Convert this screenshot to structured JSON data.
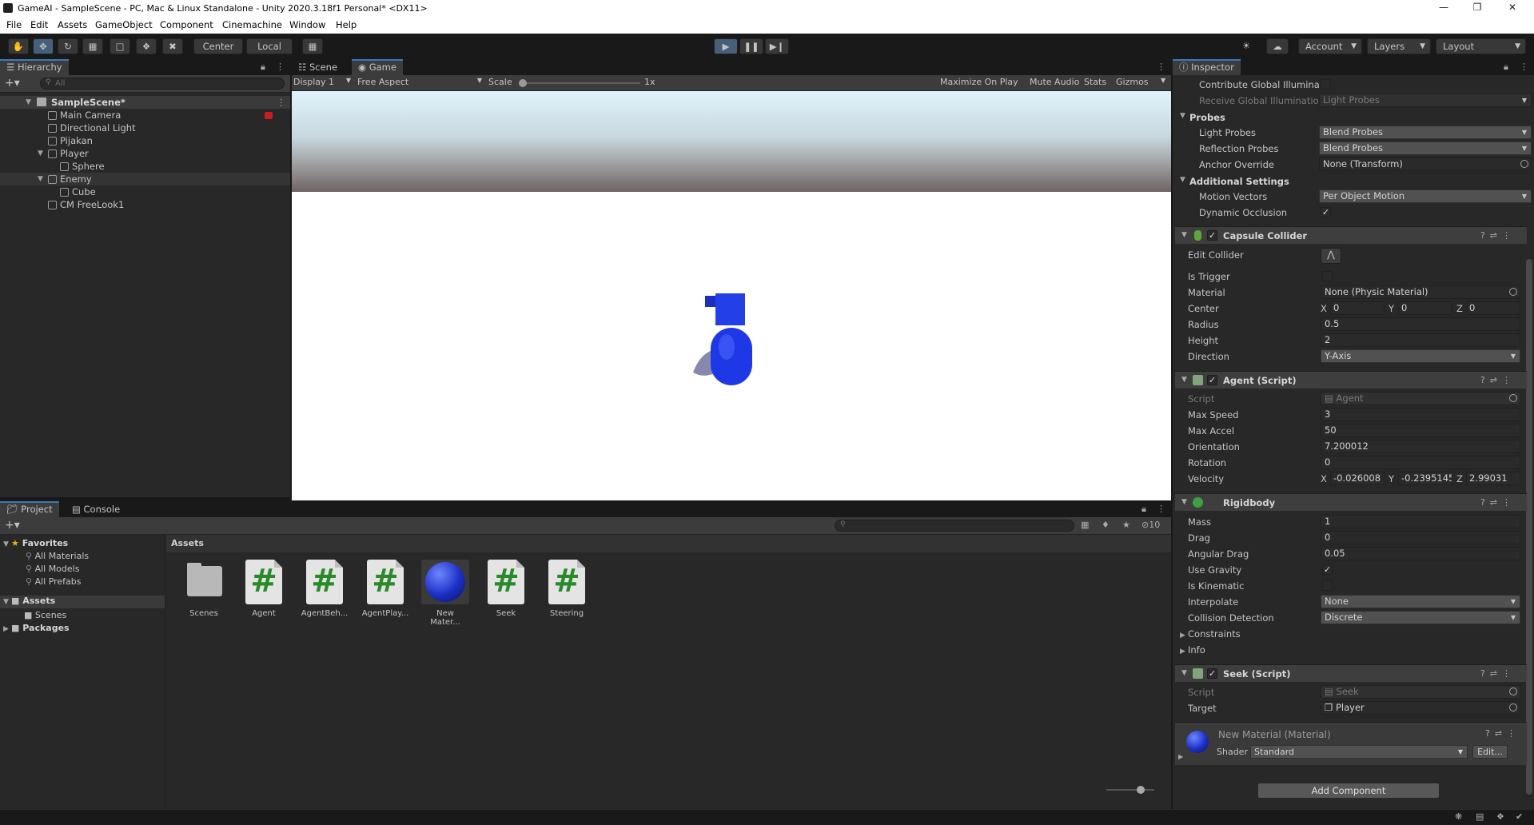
{
  "window": {
    "title": "GameAI - SampleScene - PC, Mac & Linux Standalone - Unity 2020.3.18f1 Personal* <DX11>"
  },
  "menu": [
    "File",
    "Edit",
    "Assets",
    "GameObject",
    "Component",
    "Cinemachine",
    "Window",
    "Help"
  ],
  "toolbar": {
    "pivot": "Center",
    "space": "Local",
    "account": "Account",
    "layers": "Layers",
    "layout": "Layout"
  },
  "hierarchy": {
    "tab": "Hierarchy",
    "search_placeholder": "All",
    "scene": "SampleScene*",
    "items": [
      {
        "label": "Main Camera"
      },
      {
        "label": "Directional Light"
      },
      {
        "label": "Pijakan"
      },
      {
        "label": "Player"
      },
      {
        "label": "Sphere"
      },
      {
        "label": "Enemy"
      },
      {
        "label": "Cube"
      },
      {
        "label": "CM FreeLook1"
      }
    ]
  },
  "game": {
    "tabs": [
      "Scene",
      "Game"
    ],
    "display": "Display 1",
    "aspect": "Free Aspect",
    "scale_label": "Scale",
    "scale_value": "1x",
    "buttons": [
      "Maximize On Play",
      "Mute Audio",
      "Stats",
      "Gizmos"
    ]
  },
  "project": {
    "tabs": [
      "Project",
      "Console"
    ],
    "favorites": "Favorites",
    "fav_items": [
      "All Materials",
      "All Models",
      "All Prefabs"
    ],
    "assets_label": "Assets",
    "asset_folders": [
      "Scenes"
    ],
    "packages": "Packages",
    "breadcrumb": "Assets",
    "hidden_count": "10",
    "files": [
      {
        "name": "Scenes",
        "kind": "folder"
      },
      {
        "name": "Agent",
        "kind": "script"
      },
      {
        "name": "AgentBeh...",
        "kind": "script"
      },
      {
        "name": "AgentPlay...",
        "kind": "script"
      },
      {
        "name": "New Mater...",
        "kind": "material"
      },
      {
        "name": "Seek",
        "kind": "script"
      },
      {
        "name": "Steering",
        "kind": "script"
      }
    ]
  },
  "inspector": {
    "tab": "Inspector",
    "renderer": {
      "contribute_gi": "Contribute Global Illuminat",
      "receive_gi": "Receive Global Illuminatior",
      "receive_gi_value": "Light Probes",
      "probes": "Probes",
      "light_probes": "Light Probes",
      "light_probes_value": "Blend Probes",
      "reflection_probes": "Reflection Probes",
      "reflection_probes_value": "Blend Probes",
      "anchor_override": "Anchor Override",
      "anchor_override_value": "None (Transform)",
      "additional": "Additional Settings",
      "motion_vectors": "Motion Vectors",
      "motion_vectors_value": "Per Object Motion",
      "dynamic_occlusion": "Dynamic Occlusion"
    },
    "capsule": {
      "title": "Capsule Collider",
      "edit_collider": "Edit Collider",
      "is_trigger": "Is Trigger",
      "material": "Material",
      "material_value": "None (Physic Material)",
      "center": "Center",
      "center_x": "0",
      "center_y": "0",
      "center_z": "0",
      "radius": "Radius",
      "radius_value": "0.5",
      "height": "Height",
      "height_value": "2",
      "direction": "Direction",
      "direction_value": "Y-Axis"
    },
    "agent": {
      "title": "Agent (Script)",
      "script": "Script",
      "script_value": "Agent",
      "max_speed": "Max Speed",
      "max_speed_value": "3",
      "max_accel": "Max Accel",
      "max_accel_value": "50",
      "orientation": "Orientation",
      "orientation_value": "7.200012",
      "rotation": "Rotation",
      "rotation_value": "0",
      "velocity": "Velocity",
      "vel_x": "-0.026008",
      "vel_y": "-0.2395145",
      "vel_z": "2.99031"
    },
    "rigidbody": {
      "title": "Rigidbody",
      "mass": "Mass",
      "mass_value": "1",
      "drag": "Drag",
      "drag_value": "0",
      "angular_drag": "Angular Drag",
      "angular_drag_value": "0.05",
      "use_gravity": "Use Gravity",
      "is_kinematic": "Is Kinematic",
      "interpolate": "Interpolate",
      "interpolate_value": "None",
      "collision": "Collision Detection",
      "collision_value": "Discrete",
      "constraints": "Constraints",
      "info": "Info"
    },
    "seek": {
      "title": "Seek (Script)",
      "script": "Script",
      "script_value": "Seek",
      "target": "Target",
      "target_value": "Player"
    },
    "material": {
      "title": "New Material (Material)",
      "shader": "Shader",
      "shader_value": "Standard",
      "edit": "Edit..."
    },
    "add_component": "Add Component"
  },
  "colors": {
    "accent": "#3a79bb",
    "capsule": "#1e38e6",
    "panel": "#282828"
  }
}
